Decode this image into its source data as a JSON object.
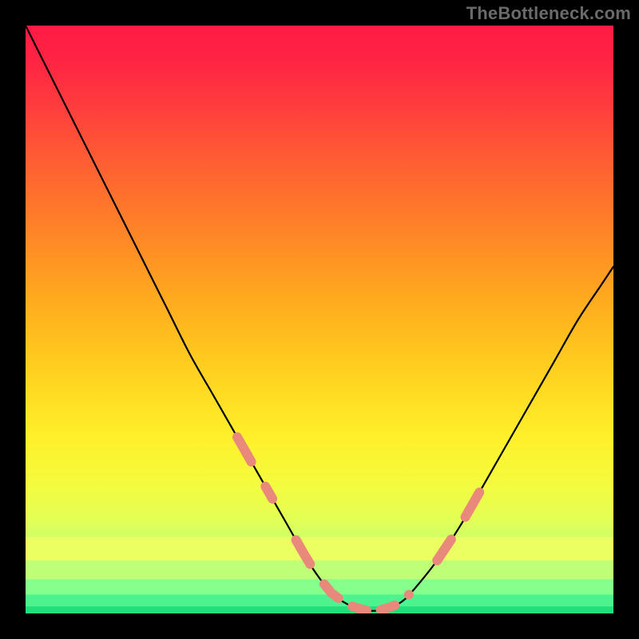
{
  "watermark": "TheBottleneck.com",
  "gradient": {
    "stops": [
      {
        "offset": 0.0,
        "color": "#ff1a45"
      },
      {
        "offset": 0.06,
        "color": "#ff2443"
      },
      {
        "offset": 0.14,
        "color": "#ff3d3d"
      },
      {
        "offset": 0.22,
        "color": "#ff5a34"
      },
      {
        "offset": 0.3,
        "color": "#ff742c"
      },
      {
        "offset": 0.38,
        "color": "#ff8e24"
      },
      {
        "offset": 0.46,
        "color": "#ffa81f"
      },
      {
        "offset": 0.54,
        "color": "#ffc21e"
      },
      {
        "offset": 0.62,
        "color": "#ffda22"
      },
      {
        "offset": 0.7,
        "color": "#fff02a"
      },
      {
        "offset": 0.78,
        "color": "#f4fb3e"
      },
      {
        "offset": 0.84,
        "color": "#e3ff55"
      },
      {
        "offset": 0.885,
        "color": "#c7ff6d"
      },
      {
        "offset": 0.92,
        "color": "#a0ff84"
      },
      {
        "offset": 0.955,
        "color": "#6dff92"
      },
      {
        "offset": 0.985,
        "color": "#39f58f"
      },
      {
        "offset": 1.0,
        "color": "#1fe57e"
      }
    ],
    "bands": [
      {
        "y0": 0.87,
        "y1": 0.91,
        "color": "#ecff62"
      },
      {
        "y0": 0.91,
        "y1": 0.942,
        "color": "#bfff78"
      },
      {
        "y0": 0.942,
        "y1": 0.968,
        "color": "#86ff8c"
      },
      {
        "y0": 0.968,
        "y1": 0.988,
        "color": "#4cf38e"
      },
      {
        "y0": 0.988,
        "y1": 1.0,
        "color": "#22df7c"
      }
    ]
  },
  "chart_data": {
    "type": "line",
    "title": "",
    "xlabel": "",
    "ylabel": "",
    "xlim": [
      0,
      100
    ],
    "ylim": [
      0,
      100
    ],
    "series": [
      {
        "name": "curve",
        "x": [
          0,
          4,
          8,
          12,
          16,
          20,
          24,
          28,
          32,
          36,
          40,
          44,
          48,
          50,
          52,
          54,
          56,
          58,
          60,
          62,
          64,
          66,
          70,
          74,
          78,
          82,
          86,
          90,
          94,
          98,
          100
        ],
        "y": [
          100,
          92,
          84,
          76,
          68,
          60,
          52,
          44,
          37,
          30,
          23,
          16,
          9,
          6,
          3.5,
          2,
          1,
          0.5,
          0.5,
          1,
          2,
          4,
          9,
          15,
          22,
          29,
          36,
          43,
          50,
          56,
          59
        ]
      }
    ],
    "highlight_segments": [
      {
        "x0": 36,
        "x1": 42,
        "side": "left"
      },
      {
        "x0": 46,
        "x1": 66,
        "side": "bottom"
      },
      {
        "x0": 70,
        "x1": 78,
        "side": "right"
      }
    ],
    "highlight_color": "#e9897c"
  }
}
